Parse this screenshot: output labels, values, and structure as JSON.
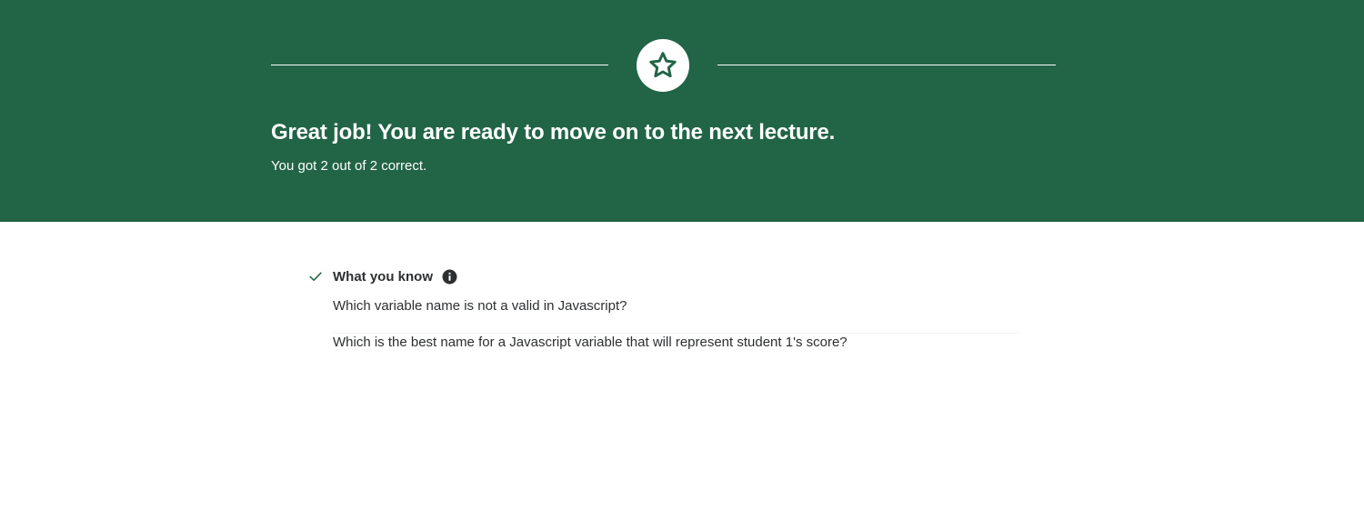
{
  "result": {
    "headline": "Great job! You are ready to move on to the next lecture.",
    "score_text": "You got 2 out of 2 correct.",
    "badge_icon": "star-icon"
  },
  "colors": {
    "banner_bg": "#216446",
    "text_dark": "#2d2f31",
    "icon_green": "#216446"
  },
  "section": {
    "title": "What you know",
    "status_icon": "check-icon",
    "info_icon": "info-icon",
    "questions": [
      {
        "text": "Which variable name is not a valid in Javascript?"
      },
      {
        "text": "Which is the best name for a Javascript variable that will represent student 1's score?"
      }
    ]
  }
}
